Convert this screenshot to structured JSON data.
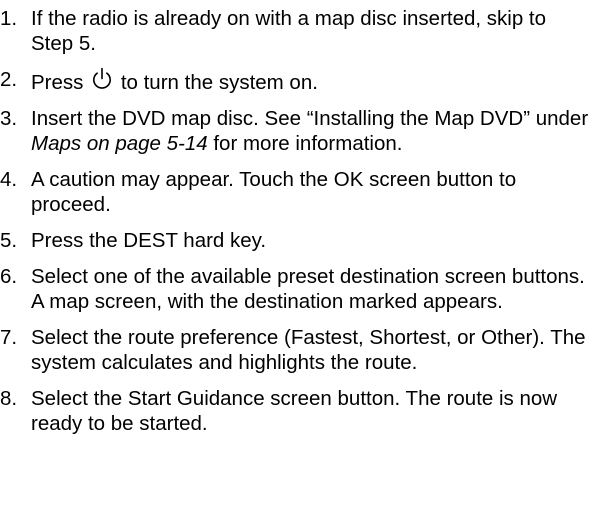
{
  "steps": [
    {
      "number": "1.",
      "text": "If the radio is already on with a map disc inserted, skip to Step 5."
    },
    {
      "number": "2.",
      "text_before": "Press",
      "icon": "power-icon",
      "text_after": "to turn the system on."
    },
    {
      "number": "3.",
      "text_before": "Insert the DVD map disc. See “Installing the Map DVD” under ",
      "link_text": "Maps on page 5-14",
      "text_after": " for more information."
    },
    {
      "number": "4.",
      "text": "A caution may appear. Touch the OK screen button to proceed."
    },
    {
      "number": "5.",
      "text": "Press the DEST hard key."
    },
    {
      "number": "6.",
      "text": "Select one of the available preset destination screen buttons. A map screen, with the destination marked appears."
    },
    {
      "number": "7.",
      "text": "Select the route preference (Fastest, Shortest, or Other). The system calculates and highlights the route."
    },
    {
      "number": "8.",
      "text": "Select the Start Guidance screen button. The route is now ready to be started."
    }
  ]
}
